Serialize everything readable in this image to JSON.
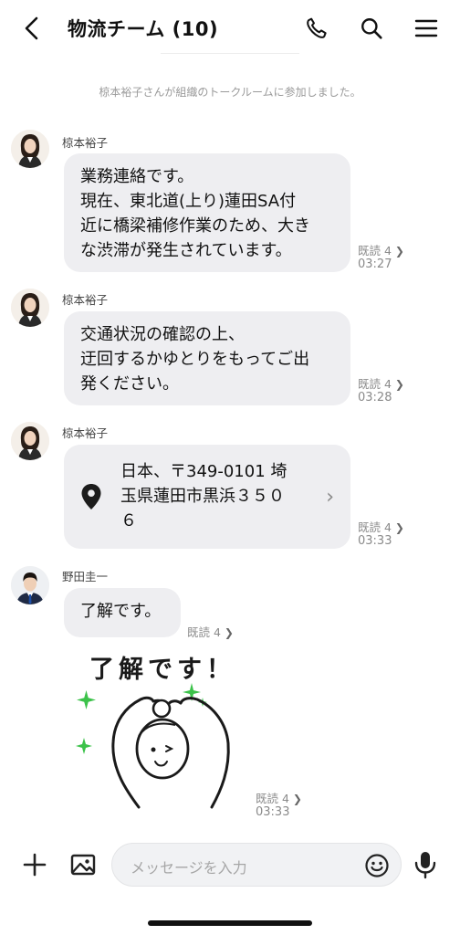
{
  "header": {
    "title": "物流チーム (10)",
    "back_icon": "chevron-left-icon",
    "call_icon": "phone-icon",
    "search_icon": "search-icon",
    "menu_icon": "hamburger-menu-icon"
  },
  "system_message": "椋本裕子さんが組織のトークルームに参加しました。",
  "messages": [
    {
      "sender": "椋本裕子",
      "lines": [
        "業務連絡です。",
        "現在、東北道(上り)蓮田SA付",
        "近に橋梁補修作業のため、大き",
        "な渋滞が発生されています。"
      ],
      "read": "既読 4",
      "time": "03:27"
    },
    {
      "sender": "椋本裕子",
      "lines": [
        "交通状況の確認の上、",
        "迂回するかゆとりをもってご出",
        "発ください。"
      ],
      "read": "既読 4",
      "time": "03:28"
    },
    {
      "sender": "椋本裕子",
      "location_lines": [
        "日本、〒349-0101 埼",
        "玉県蓮田市黒浜３５０",
        "６"
      ],
      "location_icon": "map-pin-icon",
      "read": "既読 4",
      "time": "03:33"
    },
    {
      "sender": "野田圭一",
      "lines": [
        "了解です。"
      ],
      "read": "既読 4"
    },
    {
      "sticker_text": "了解です！",
      "read": "既読 4",
      "time": "03:33"
    }
  ],
  "input": {
    "placeholder": "メッセージを入力",
    "plus_icon": "plus-icon",
    "image_icon": "image-icon",
    "emoji_icon": "emoji-icon",
    "mic_icon": "microphone-icon"
  },
  "colors": {
    "bubble": "#eeeef1",
    "sticker_sparkle": "#3cc24a"
  }
}
